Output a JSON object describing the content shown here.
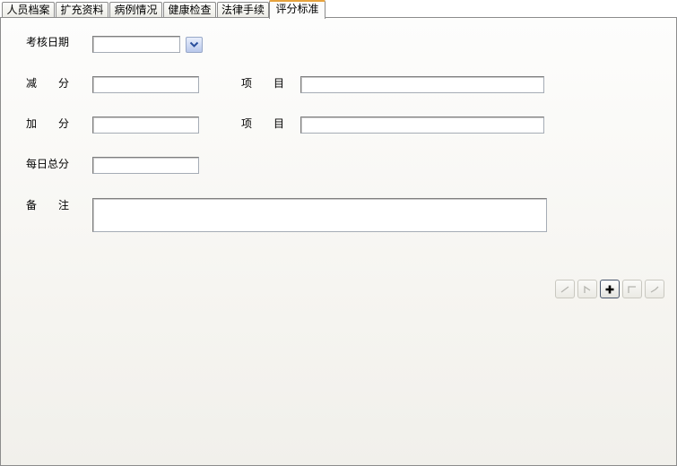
{
  "tabs": [
    {
      "label": "人员档案",
      "active": false
    },
    {
      "label": "扩充资料",
      "active": false
    },
    {
      "label": "病例情况",
      "active": false
    },
    {
      "label": "健康检查",
      "active": false
    },
    {
      "label": "法律手续",
      "active": false
    },
    {
      "label": "评分标准",
      "active": true
    }
  ],
  "form": {
    "date_label": "考核日期",
    "date_value": "",
    "deduct_label": "减分",
    "deduct_value": "",
    "deduct_item_label": "项目",
    "deduct_item_value": "",
    "add_label": "加分",
    "add_value": "",
    "add_item_label": "项目",
    "add_item_value": "",
    "daily_total_label": "每日总分",
    "daily_total_value": "",
    "remark_label": "备注",
    "remark_value": ""
  },
  "icons": {
    "dropdown": "chevron-down-icon",
    "nav": [
      "first-record-icon",
      "previous-record-icon",
      "add-record-icon",
      "next-record-icon",
      "last-record-icon"
    ]
  },
  "colors": {
    "active_tab_accent": "#e6a23c",
    "dropdown_chevron": "#2a4f9c",
    "disabled_icon": "#b4b4ae"
  }
}
